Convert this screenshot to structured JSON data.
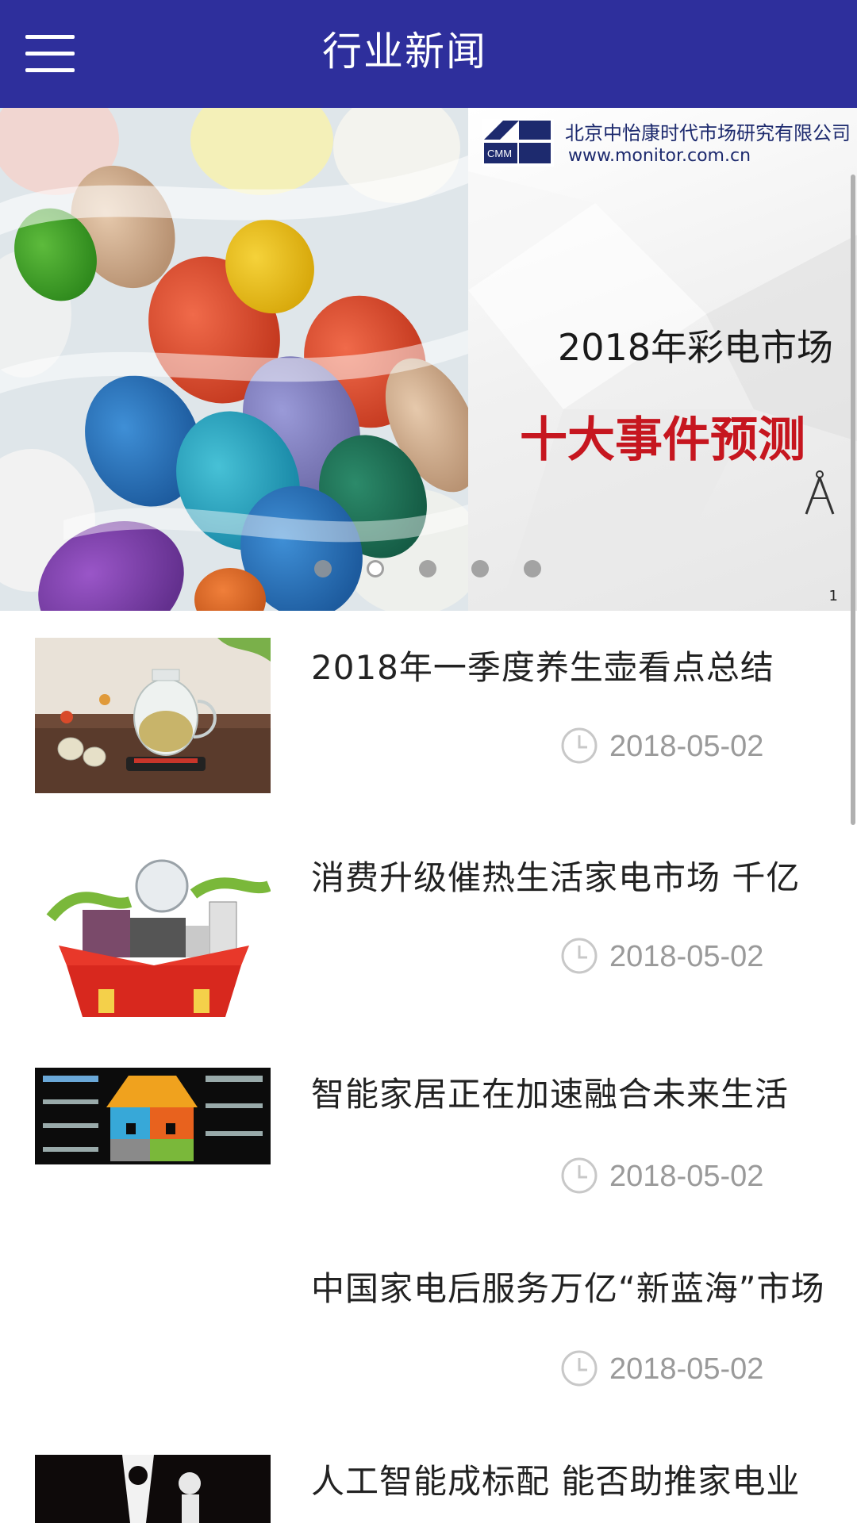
{
  "app_bar": {
    "title": "行业新闻",
    "menu_icon": "hamburger-menu-icon"
  },
  "banner": {
    "company_name": "北京中怡康时代市场研究有限公司",
    "logo_text": "CMM",
    "url": "www.monitor.com.cn",
    "headline": "2018年彩电市场",
    "subheadline": "十大事件预测",
    "page_number": "1",
    "carousel": {
      "total": 5,
      "active_index": 1
    },
    "compass_icon": "compass-icon"
  },
  "news": {
    "items": [
      {
        "title": "2018年一季度养生壶看点总结",
        "date": "2018-05-02",
        "thumbnail": "health-kettle-photo"
      },
      {
        "title": "消费升级催热生活家电市场 千亿",
        "date": "2018-05-02",
        "thumbnail": "appliance-gift-box-illustration"
      },
      {
        "title": "智能家居正在加速融合未来生活",
        "date": "2018-05-02",
        "thumbnail": "smart-home-puzzle-diagram"
      },
      {
        "title": "中国家电后服务万亿“新蓝海”市场",
        "date": "2018-05-02",
        "thumbnail": ""
      },
      {
        "title": "人工智能成标配 能否助推家电业",
        "date": "",
        "thumbnail": "ai-silhouette-photo"
      }
    ],
    "date_icon": "clock-icon"
  },
  "colors": {
    "app_bar": "#2e2f9c",
    "title_text": "#ffffff",
    "news_title": "#222222",
    "date_text": "#9a9a9a",
    "banner_subheadline": "#c6161f"
  }
}
